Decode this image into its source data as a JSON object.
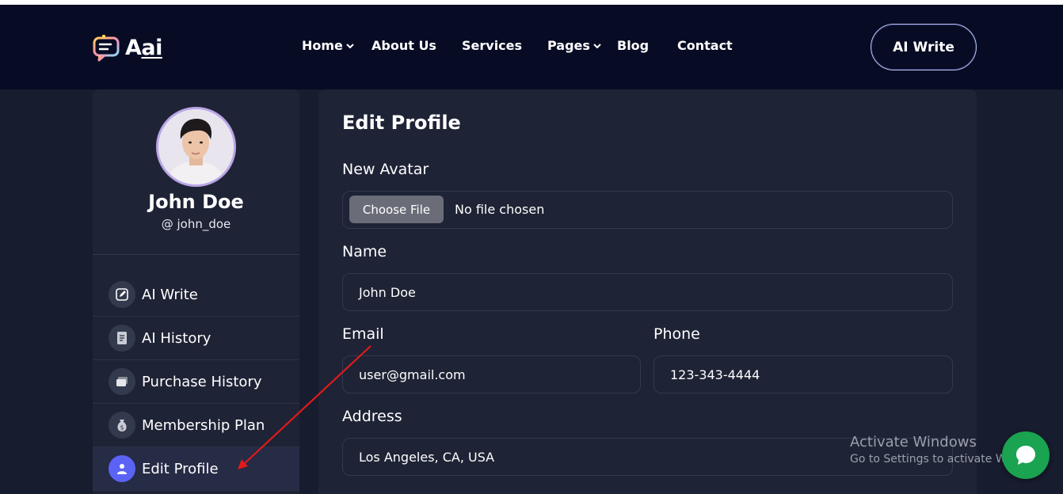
{
  "colors": {
    "page_bg": "#171c2e",
    "header_bg": "#070c24",
    "card_bg": "#1f2336",
    "accent": "#5b63f5",
    "file_button": "#6a6d78",
    "fab_green": "#1aa350",
    "annotation_arrow": "#e01b1b"
  },
  "header": {
    "logo": {
      "text_prefix": "A",
      "text_underlined": "ai",
      "icon": "chat-bubble-logo-icon"
    },
    "nav": [
      {
        "label": "Home",
        "dropdown": true
      },
      {
        "label": "About Us",
        "dropdown": false
      },
      {
        "label": "Services",
        "dropdown": false
      },
      {
        "label": "Pages",
        "dropdown": true
      },
      {
        "label": "Blog",
        "dropdown": false
      },
      {
        "label": "Contact",
        "dropdown": false
      }
    ],
    "cta_label": "AI Write"
  },
  "sidebar": {
    "avatar_icon": "user-photo-avatar",
    "name": "John Doe",
    "handle": "@ john_doe",
    "items": [
      {
        "label": "AI Write",
        "icon": "edit-icon",
        "active": false
      },
      {
        "label": "AI History",
        "icon": "document-list-icon",
        "active": false
      },
      {
        "label": "Purchase History",
        "icon": "card-icon",
        "active": false
      },
      {
        "label": "Membership Plan",
        "icon": "money-bag-icon",
        "active": false
      },
      {
        "label": "Edit Profile",
        "icon": "user-icon",
        "active": true
      }
    ]
  },
  "form": {
    "title": "Edit Profile",
    "avatar_label": "New Avatar",
    "file_button_label": "Choose File",
    "file_status": "No file chosen",
    "name_label": "Name",
    "name_value": "John Doe",
    "email_label": "Email",
    "email_value": "user@gmail.com",
    "phone_label": "Phone",
    "phone_value": "123-343-4444",
    "address_label": "Address",
    "address_value": "Los Angeles, CA, USA"
  },
  "overlay": {
    "activate_title": "Activate Windows",
    "activate_sub": "Go to Settings to activate Windows.",
    "chat_icon": "chat-bubble-icon"
  }
}
